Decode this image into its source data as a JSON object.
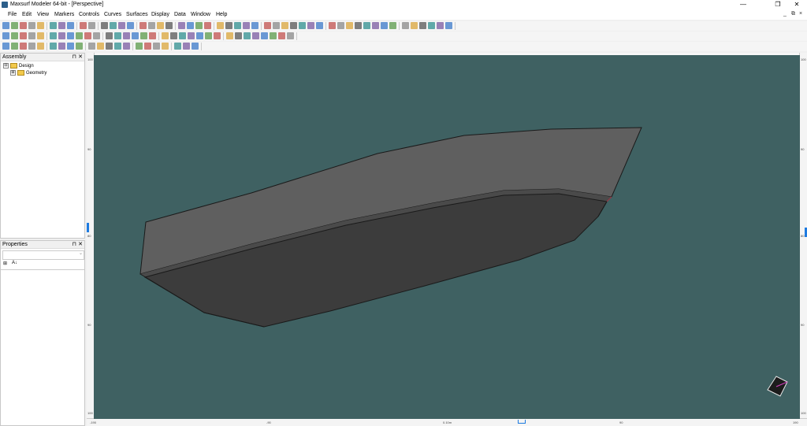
{
  "window": {
    "title": "Maxsurf Modeler 64-bit - [Perspective]",
    "minimize": "—",
    "maximize": "❐",
    "close": "✕"
  },
  "menu": [
    "File",
    "Edit",
    "View",
    "Markers",
    "Controls",
    "Curves",
    "Surfaces",
    "Display",
    "Data",
    "Window",
    "Help"
  ],
  "mdi_controls": [
    "_",
    "⧉",
    "×"
  ],
  "assembly_panel": {
    "title": "Assembly",
    "pin": "⊓",
    "close": "✕",
    "tree": [
      {
        "label": "Design",
        "expander": "⊟"
      },
      {
        "label": "Geometry",
        "expander": "⊞"
      }
    ]
  },
  "properties_panel": {
    "title": "Properties",
    "pin": "⊓",
    "close": "✕",
    "sort_categorized_icon": "⊞",
    "sort_alpha_icon": "A↓"
  },
  "viewport": {
    "view": "Perspective",
    "background_color": "#3f6162",
    "hull_colors": {
      "topside": "#5f5f5f",
      "bottom": "#3c3c3c",
      "deck": "#4a4a4a"
    },
    "bottom_ruler_labels": [
      "-190",
      "-90",
      "0.10m",
      "90",
      "190"
    ],
    "left_ruler_labels": [
      "100",
      "90",
      "80",
      "90",
      "100"
    ],
    "right_ruler_labels": [
      "100",
      "90",
      "80",
      "90",
      "100"
    ]
  }
}
